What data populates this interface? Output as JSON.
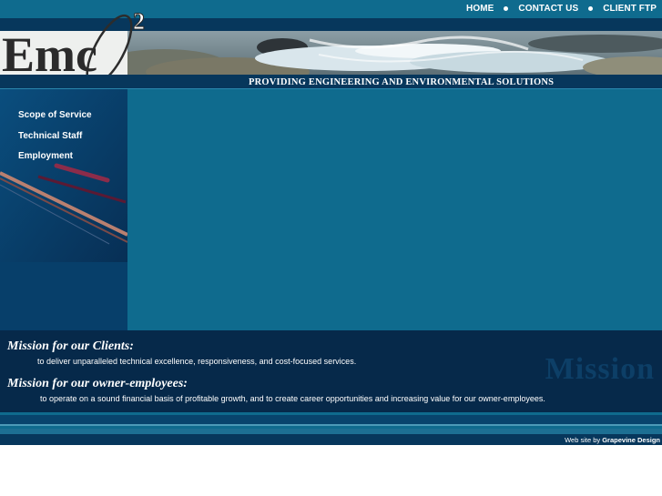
{
  "nav": {
    "home": "HOME",
    "contact": "CONTACT US",
    "ftp": "CLIENT FTP"
  },
  "logo": {
    "text": "Emc",
    "superscript": "2"
  },
  "tagline": "PROVIDING ENGINEERING AND ENVIRONMENTAL SOLUTIONS",
  "sidebar": {
    "items": [
      {
        "label": "Scope of Service"
      },
      {
        "label": "Technical Staff"
      },
      {
        "label": "Employment"
      }
    ]
  },
  "mission": {
    "watermark": "Mission",
    "clients_heading": "Mission for our Clients:",
    "clients_text": "to deliver unparalleled technical excellence, responsiveness, and cost-focused services.",
    "employees_heading": "Mission for our owner-employees:",
    "employees_text": "to operate on a sound financial basis of profitable growth, and to create career opportunities and increasing value for our owner-employees."
  },
  "footer": {
    "credit_prefix": "Web site by",
    "credit_name": "Grapevine Design"
  },
  "colors": {
    "teal": "#0f6b8e",
    "navy": "#07375c",
    "deep_navy": "#06294a"
  }
}
